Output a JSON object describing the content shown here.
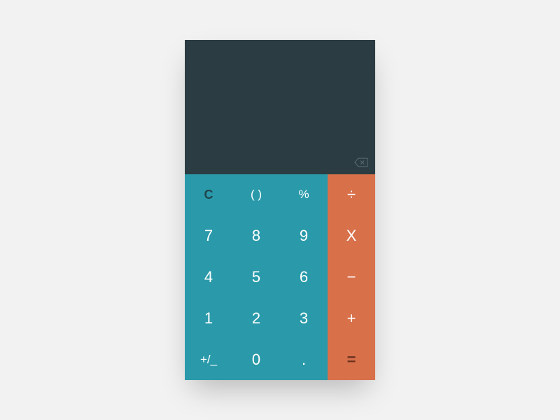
{
  "display": {
    "value": ""
  },
  "keys": {
    "clear": "C",
    "parens": "( )",
    "percent": "%",
    "divide": "÷",
    "seven": "7",
    "eight": "8",
    "nine": "9",
    "multiply": "X",
    "four": "4",
    "five": "5",
    "six": "6",
    "subtract": "−",
    "one": "1",
    "two": "2",
    "three": "3",
    "add": "+",
    "sign": "+/_",
    "zero": "0",
    "decimal": ".",
    "equals": "="
  },
  "colors": {
    "display_bg": "#2b3d42",
    "main_key_bg": "#2a9aaa",
    "op_key_bg": "#d8704a",
    "page_bg": "#f2f2f2"
  }
}
